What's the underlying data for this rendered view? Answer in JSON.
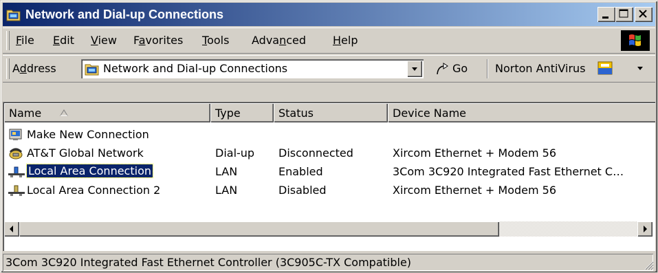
{
  "window": {
    "title": "Network and Dial-up Connections",
    "controls": [
      "minimize",
      "maximize",
      "close"
    ]
  },
  "menu": {
    "items": [
      {
        "pre": "",
        "key": "F",
        "post": "ile"
      },
      {
        "pre": "",
        "key": "E",
        "post": "dit"
      },
      {
        "pre": "",
        "key": "V",
        "post": "iew"
      },
      {
        "pre": "F",
        "key": "a",
        "post": "vorites"
      },
      {
        "pre": "",
        "key": "T",
        "post": "ools"
      },
      {
        "pre": "Adva",
        "key": "n",
        "post": "ced"
      },
      {
        "pre": "",
        "key": "H",
        "post": "elp"
      }
    ]
  },
  "addressbar": {
    "label_pre": "A",
    "label_key": "d",
    "label_post": "dress",
    "value": "Network and Dial-up Connections",
    "go_label": "Go",
    "norton_label": "Norton AntiVirus"
  },
  "listview": {
    "columns": [
      "Name",
      "Type",
      "Status",
      "Device Name"
    ],
    "sorted_column": "Name",
    "rows": [
      {
        "icon": "new-connection-icon",
        "name": "Make New Connection",
        "type": "",
        "status": "",
        "device": ""
      },
      {
        "icon": "dialup-phone-icon",
        "name": "AT&T Global Network",
        "type": "Dial-up",
        "status": "Disconnected",
        "device": "Xircom Ethernet + Modem 56"
      },
      {
        "icon": "lan-connection-icon",
        "name": "Local Area Connection",
        "type": "LAN",
        "status": "Enabled",
        "device": "3Com 3C920 Integrated Fast Ethernet C…",
        "selected": true
      },
      {
        "icon": "lan-connection-icon",
        "name": "Local Area Connection 2",
        "type": "LAN",
        "status": "Disabled",
        "device": "Xircom Ethernet + Modem 56"
      }
    ]
  },
  "statusbar": {
    "text": "3Com 3C920 Integrated Fast Ethernet Controller (3C905C-TX Compatible)"
  },
  "colors": {
    "titlebar_start": "#0a246a",
    "titlebar_end": "#a6caf0",
    "face": "#d4d0c8",
    "selection": "#0a246a"
  }
}
